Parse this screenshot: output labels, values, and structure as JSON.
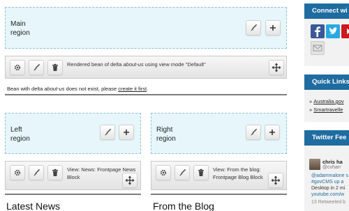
{
  "main_region": {
    "label_line1": "Main",
    "label_line2": "region"
  },
  "main_bean": {
    "text_prefix": "Rendered bean of delta ",
    "text_delta": "about-us",
    "text_suffix": " using view mode \"Default\"",
    "note_prefix": "Bean with delta ",
    "note_delta": "about-us",
    "note_middle": " does not exist, please ",
    "note_link": "create it first",
    "note_end": "."
  },
  "left_region": {
    "label_line1": "Left",
    "label_line2": "region",
    "view_line1": "View: News: Frontpage News",
    "view_line2": "Block",
    "block_title": "Latest News"
  },
  "right_region": {
    "label_line1": "Right",
    "label_line2": "region",
    "view_line1": "View: From the blog:",
    "view_line2": "Frontpage Blog Block",
    "block_title": "From the Blog"
  },
  "sidebar": {
    "connect_title": "Connect wi",
    "quick_links_title": "Quick Links",
    "quick_links": [
      "Australia.gov",
      "Smartravelle"
    ],
    "twitter_title": "Twitter Fee",
    "tweet_name": "chris ha",
    "tweet_handle": "@cvharr",
    "tweet_lines": [
      "@adammalone s",
      "#govCMS up a",
      "Desktop in 2 mi",
      "youtube.com/w",
      "13 Retweeted b"
    ]
  },
  "colors": {
    "region_bg": "#e6f6fb",
    "region_border": "#8ec3d6",
    "sidebar_header": "#1e6ca0",
    "facebook": "#3b5998",
    "twitter": "#29a9e1",
    "youtube": "#cc181e"
  },
  "icons": {
    "edit": "paintbrush-icon",
    "add": "plus-icon",
    "configure": "gear-icon",
    "delete": "trash-icon",
    "move": "move-arrows-icon"
  }
}
